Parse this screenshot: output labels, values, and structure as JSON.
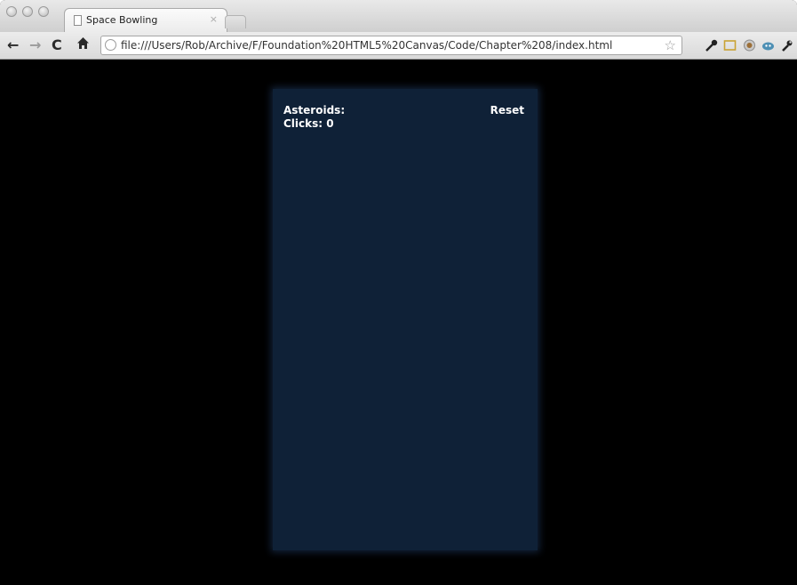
{
  "browser": {
    "tab_title": "Space Bowling",
    "tab_close": "×",
    "url": "file:///Users/Rob/Archive/F/Foundation%20HTML5%20Canvas/Code/Chapter%208/index.html",
    "nav": {
      "back_icon": "arrow-left-icon",
      "forward_icon": "arrow-right-icon",
      "reload_icon": "reload-icon",
      "home_icon": "home-icon"
    },
    "extensions": [
      "key-icon",
      "screen-icon",
      "globe-icon",
      "cloud-icon",
      "wrench-icon"
    ]
  },
  "game": {
    "asteroids_label": "Asteroids:",
    "clicks_label": "Clicks: 0",
    "reset_label": "Reset",
    "colors": {
      "page_bg": "#000000",
      "game_bg": "#0f2137",
      "text": "#ffffff"
    }
  }
}
